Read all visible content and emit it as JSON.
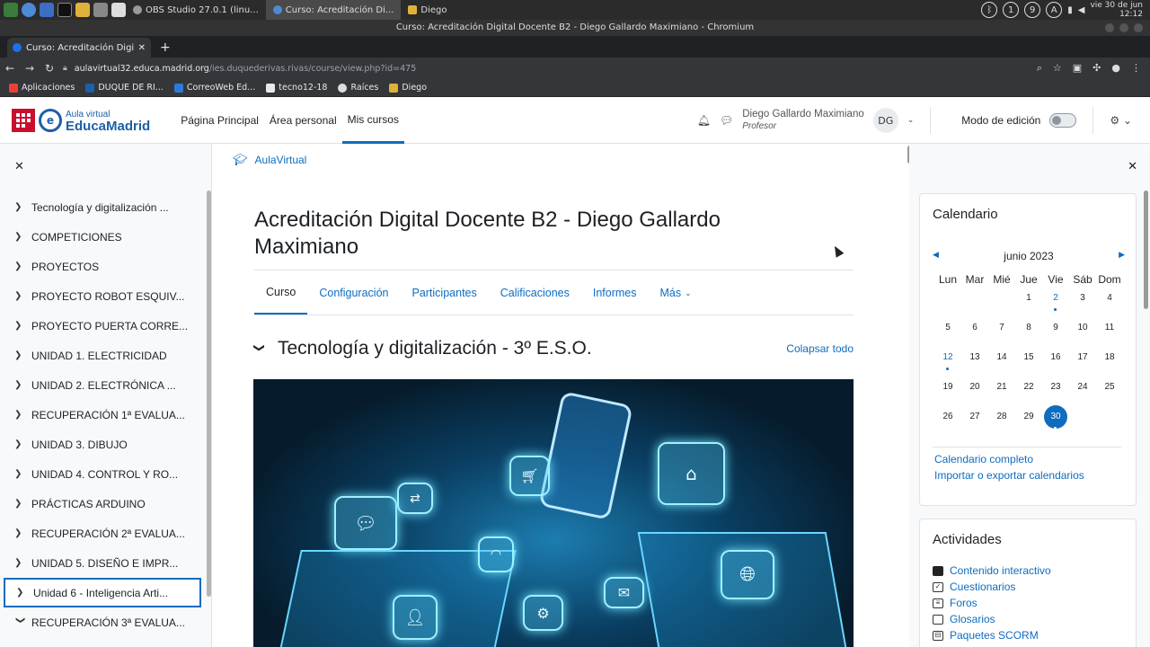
{
  "os": {
    "tasks": [
      {
        "label": "OBS Studio 27.0.1 (linu..."
      },
      {
        "label": "Curso: Acreditación Di..."
      },
      {
        "label": "Diego"
      }
    ],
    "tray": [
      "1",
      "9",
      "A"
    ],
    "clock_line1": "vie 30 de jun",
    "clock_line2": "12:12"
  },
  "browser": {
    "window_title": "Curso: Acreditación Digital Docente B2 - Diego Gallardo Maximiano - Chromium",
    "tab_title": "Curso: Acreditación Digit",
    "url_host": "aulavirtual32.educa.madrid.org",
    "url_path": "/ies.duquederivas.rivas/course/view.php?id=475",
    "bookmarks": [
      "Aplicaciones",
      "DUQUE DE RI...",
      "CorreoWeb Ed...",
      "tecno12-18",
      "Raíces",
      "Diego"
    ]
  },
  "moodle_nav": {
    "logo_line1": "Aula virtual",
    "logo_line2": "EducaMadrid",
    "links": [
      "Página Principal",
      "Área personal",
      "Mis cursos"
    ],
    "user_name": "Diego Gallardo Maximiano",
    "user_role": "Profesor",
    "avatar_initials": "DG",
    "edit_mode_label": "Modo de edición"
  },
  "course_index": {
    "items": [
      "Tecnología y digitalización ...",
      "COMPETICIONES",
      "PROYECTOS",
      "PROYECTO ROBOT ESQUIV...",
      "PROYECTO PUERTA CORRE...",
      "UNIDAD 1. ELECTRICIDAD",
      "UNIDAD 2. ELECTRÓNICA ...",
      "RECUPERACIÓN 1ª EVALUA...",
      "UNIDAD 3. DIBUJO",
      "UNIDAD 4. CONTROL Y RO...",
      "PRÁCTICAS ARDUINO",
      "RECUPERACIÓN 2ª EVALUA...",
      "UNIDAD 5. DISEÑO E IMPR...",
      "Unidad 6 - Inteligencia Arti...",
      "RECUPERACIÓN 3ª EVALUA..."
    ]
  },
  "main": {
    "breadcrumb": "AulaVirtual",
    "title": "Acreditación Digital Docente B2 - Diego Gallardo Maximiano",
    "tabs": [
      "Curso",
      "Configuración",
      "Participantes",
      "Calificaciones",
      "Informes",
      "Más"
    ],
    "section_title": "Tecnología y digitalización - 3º E.S.O.",
    "collapse_all": "Colapsar todo"
  },
  "calendar": {
    "title": "Calendario",
    "month": "junio 2023",
    "weekdays": [
      "Lun",
      "Mar",
      "Mié",
      "Jue",
      "Vie",
      "Sáb",
      "Dom"
    ],
    "weeks": [
      [
        "",
        "",
        "",
        "1",
        "2",
        "3",
        "4"
      ],
      [
        "5",
        "6",
        "7",
        "8",
        "9",
        "10",
        "11"
      ],
      [
        "12",
        "13",
        "14",
        "15",
        "16",
        "17",
        "18"
      ],
      [
        "19",
        "20",
        "21",
        "22",
        "23",
        "24",
        "25"
      ],
      [
        "26",
        "27",
        "28",
        "29",
        "30",
        "",
        ""
      ]
    ],
    "event_days": [
      "2",
      "12"
    ],
    "today": "30",
    "link_full": "Calendario completo",
    "link_export": "Importar o exportar calendarios"
  },
  "activities": {
    "title": "Actividades",
    "items": [
      "Contenido interactivo",
      "Cuestionarios",
      "Foros",
      "Glosarios",
      "Paquetes SCORM"
    ]
  },
  "colors": {
    "accent": "#0f6cbf",
    "brand_red": "#c8102e",
    "brand_blue": "#1d5fa8"
  }
}
